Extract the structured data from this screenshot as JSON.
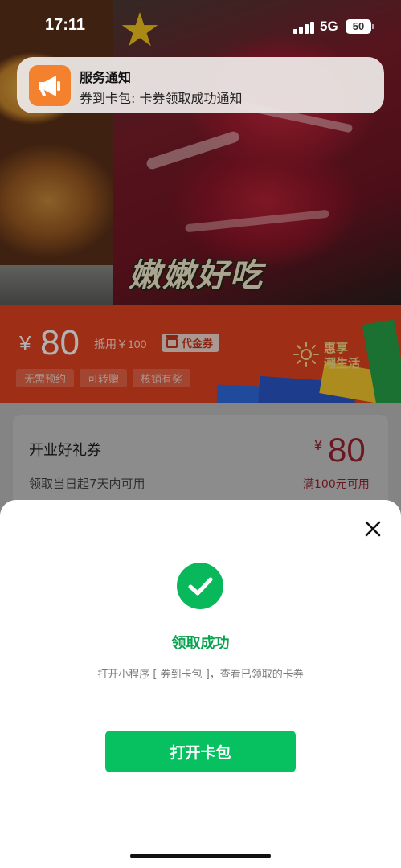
{
  "status_bar": {
    "time": "17:11",
    "network": "5G",
    "battery": "50"
  },
  "notification": {
    "app_name": "服务通知",
    "message": "券到卡包: 卡券领取成功通知",
    "icon": "megaphone-icon"
  },
  "hero": {
    "caption": "嫩嫩好吃"
  },
  "banner": {
    "currency": "¥",
    "amount": "80",
    "condition": "抵用￥100",
    "tag": "代金券",
    "chips": [
      "无需预约",
      "可转赠",
      "核销有奖"
    ],
    "slogan_line1": "惠享",
    "slogan_line2": "潮生活"
  },
  "coupon_card": {
    "title": "开业好礼券",
    "validity": "领取当日起7天内可用",
    "currency": "¥",
    "amount": "80",
    "condition": "满100元可用"
  },
  "sheet": {
    "success_title": "领取成功",
    "success_desc": "打开小程序 [ 券到卡包 ]，查看已领取的卡券",
    "open_button": "打开卡包"
  },
  "colors": {
    "accent_green": "#07c160",
    "banner_orange": "#e3421f",
    "coupon_red": "#9a2230",
    "notification_icon": "#f4812d"
  }
}
